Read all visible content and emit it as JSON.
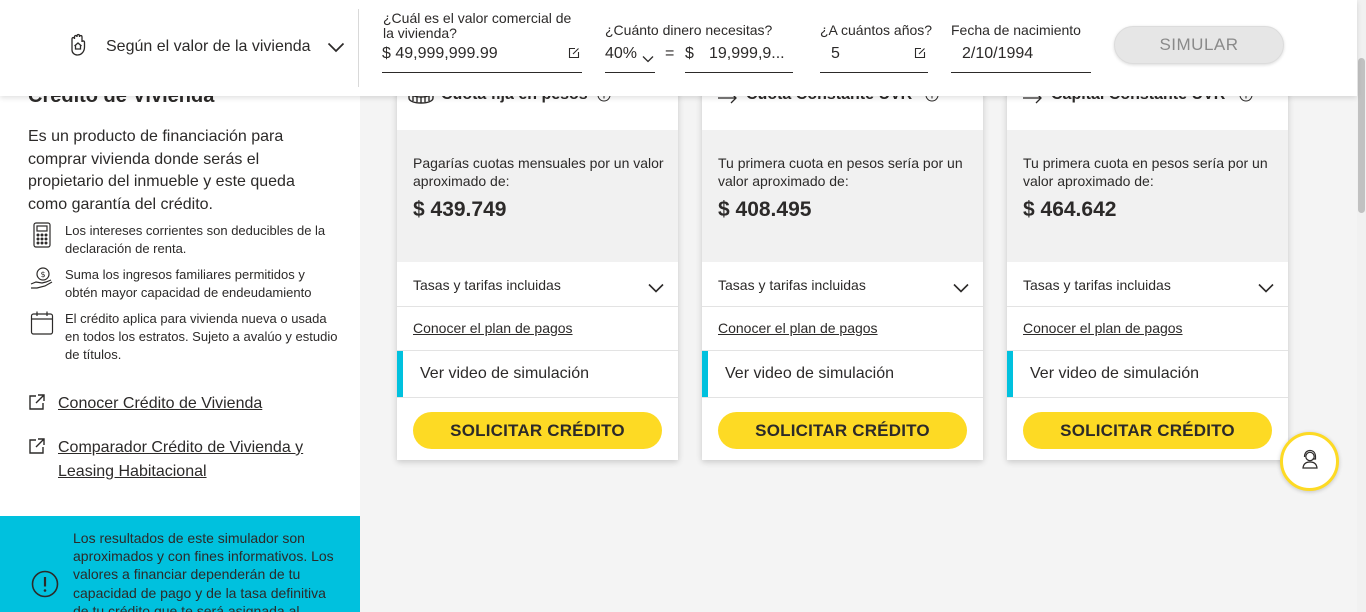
{
  "left_panel": {
    "title": "Crédito de Vivienda",
    "description": "Es un producto de financiación para comprar vivienda donde serás el propietario del inmueble y este queda como garantía del crédito.",
    "features": [
      {
        "icon": "calculator-icon",
        "text": "Los intereses corrientes son deducibles de la declaración de renta."
      },
      {
        "icon": "money-hand-icon",
        "text": "Suma los ingresos familiares permitidos y obtén mayor capacidad de endeudamiento"
      },
      {
        "icon": "calendar-icon",
        "text": "El crédito aplica para vivienda nueva o usada en todos los estratos. Sujeto a avalúo y estudio de títulos."
      }
    ],
    "links": [
      {
        "icon": "external-link-icon",
        "label": "Conocer Crédito de Vivienda"
      },
      {
        "icon": "external-link-icon",
        "label": "Comparador Crédito de Vivienda y Leasing Habitacional"
      }
    ],
    "notice": {
      "icon": "alert-icon",
      "text": "Los resultados de este simulador son aproximados y con fines informativos. Los valores a financiar dependerán de tu capacidad de pago y de la tasa definitiva de tu crédito que te será asignada al"
    }
  },
  "topbar": {
    "mode_label": "Según el valor de la vivienda",
    "home_value": {
      "label": "¿Cuál es el valor comercial de la vivienda?",
      "value": "$ 49,999,999.99"
    },
    "money_needed": {
      "label": "¿Cuánto dinero necesitas?",
      "percent": "40%",
      "equals": "=",
      "currency": "$",
      "amount": "19,999,9..."
    },
    "years": {
      "label": "¿A cuántos años?",
      "value": "5"
    },
    "birth_date": {
      "label": "Fecha de nacimiento",
      "value": "2/10/1994"
    },
    "simulate_label": "SIMULAR"
  },
  "cards": [
    {
      "title": "Cuota fija en pesos",
      "icon": "coins-icon",
      "text": "Pagarías cuotas mensuales por un valor aproximado de:",
      "amount": "$ 439.749",
      "rates_label": "Tasas y tarifas incluidas",
      "plan_label": "Conocer el plan de pagos",
      "video_label": "Ver video de simulación",
      "button_label": "SOLICITAR CRÉDITO"
    },
    {
      "title": "Cuota Constante UVR",
      "icon": "arrow-right-icon",
      "text": "Tu primera cuota en pesos sería por un valor aproximado de:",
      "amount": "$ 408.495",
      "rates_label": "Tasas y tarifas incluidas",
      "plan_label": "Conocer el plan de pagos",
      "video_label": "Ver video de simulación",
      "button_label": "SOLICITAR CRÉDITO"
    },
    {
      "title": "Capital Constante UVR",
      "icon": "arrow-right-icon",
      "text": "Tu primera cuota en pesos sería por un valor aproximado de:",
      "amount": "$ 464.642",
      "rates_label": "Tasas y tarifas incluidas",
      "plan_label": "Conocer el plan de pagos",
      "video_label": "Ver video de simulación",
      "button_label": "SOLICITAR CRÉDITO"
    }
  ],
  "colors": {
    "accent_yellow": "#fdda24",
    "accent_cyan": "#00c1de",
    "text": "#2c2a29"
  },
  "floating_button_icon": "support-agent-icon"
}
